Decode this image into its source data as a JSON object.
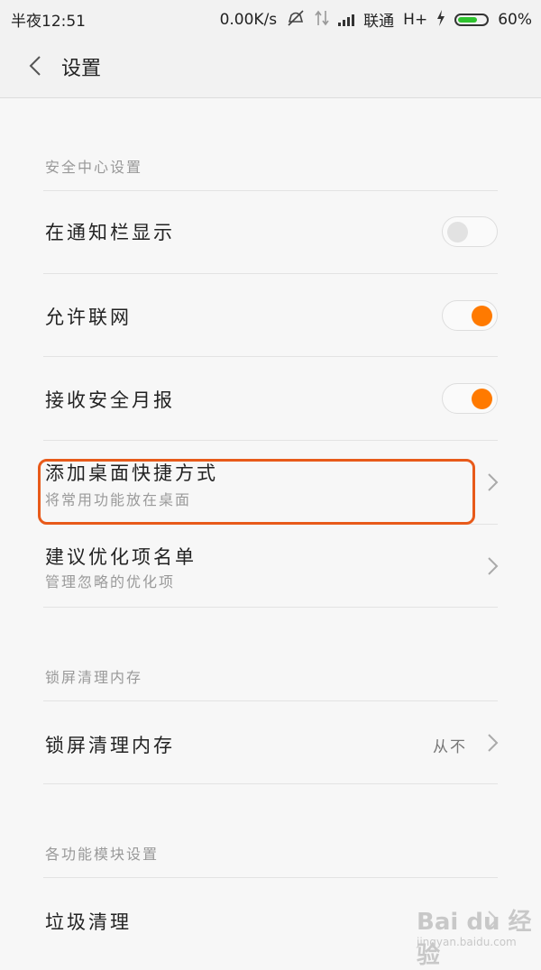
{
  "status": {
    "time": "半夜12:51",
    "speed": "0.00K/s",
    "carrier": "联通",
    "network": "H+",
    "battery": "60%",
    "battery_level": 0.6,
    "battery_color": "#2ec32e"
  },
  "header": {
    "title": "设置"
  },
  "sections": [
    {
      "title": "安全中心设置",
      "items": [
        {
          "label": "在通知栏显示",
          "toggle": "off"
        },
        {
          "label": "允许联网",
          "toggle": "on"
        },
        {
          "label": "接收安全月报",
          "toggle": "on"
        },
        {
          "label": "添加桌面快捷方式",
          "sub": "将常用功能放在桌面",
          "highlighted": true
        },
        {
          "label": "建议优化项名单",
          "sub": "管理忽略的优化项"
        }
      ]
    },
    {
      "title": "锁屏清理内存",
      "items": [
        {
          "label": "锁屏清理内存",
          "value": "从不"
        }
      ]
    },
    {
      "title": "各功能模块设置",
      "items": [
        {
          "label": "垃圾清理"
        }
      ]
    }
  ],
  "watermark": {
    "text": "Bai du 经验",
    "sub": "jingyan.baidu.com"
  },
  "colors": {
    "accent": "#ff7a00",
    "highlight": "#e85a1a"
  }
}
